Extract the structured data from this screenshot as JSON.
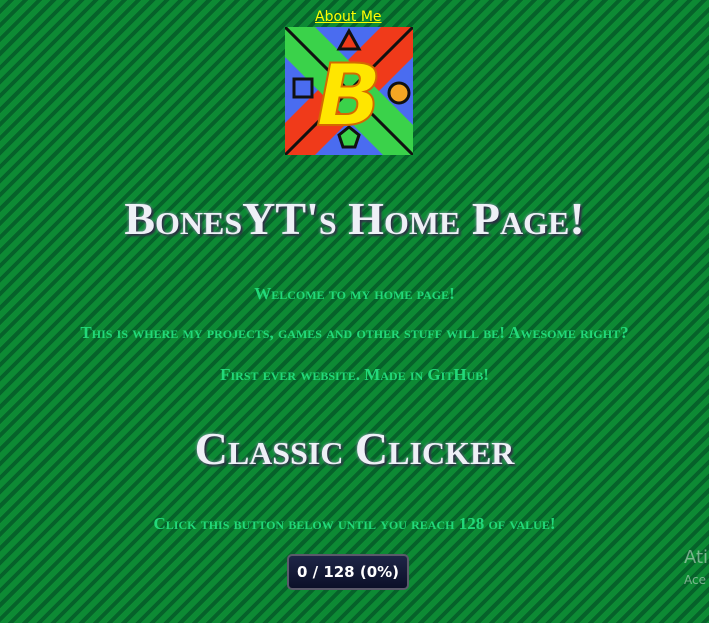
{
  "nav": {
    "about_link": "About Me"
  },
  "logo": {
    "letter": "B",
    "colors": {
      "yellow": "#ffe600",
      "blue": "#4a6cf0",
      "red": "#f03a1a",
      "green": "#3ad24a",
      "orange": "#f5a623"
    }
  },
  "page": {
    "title": "BonesYT's Home Page!",
    "intro_lines": [
      "Welcome to my home page!",
      "This is where my projects, games and other stuff will be! Awesome right?",
      "First ever website. Made in GitHub!"
    ]
  },
  "clicker": {
    "title": "Classic Clicker",
    "instruction": "Click this button below until you reach 128 of value!",
    "button_label": "0 / 128 (0%)"
  },
  "watermark": {
    "line1": "Ati",
    "line2": "Ace"
  }
}
